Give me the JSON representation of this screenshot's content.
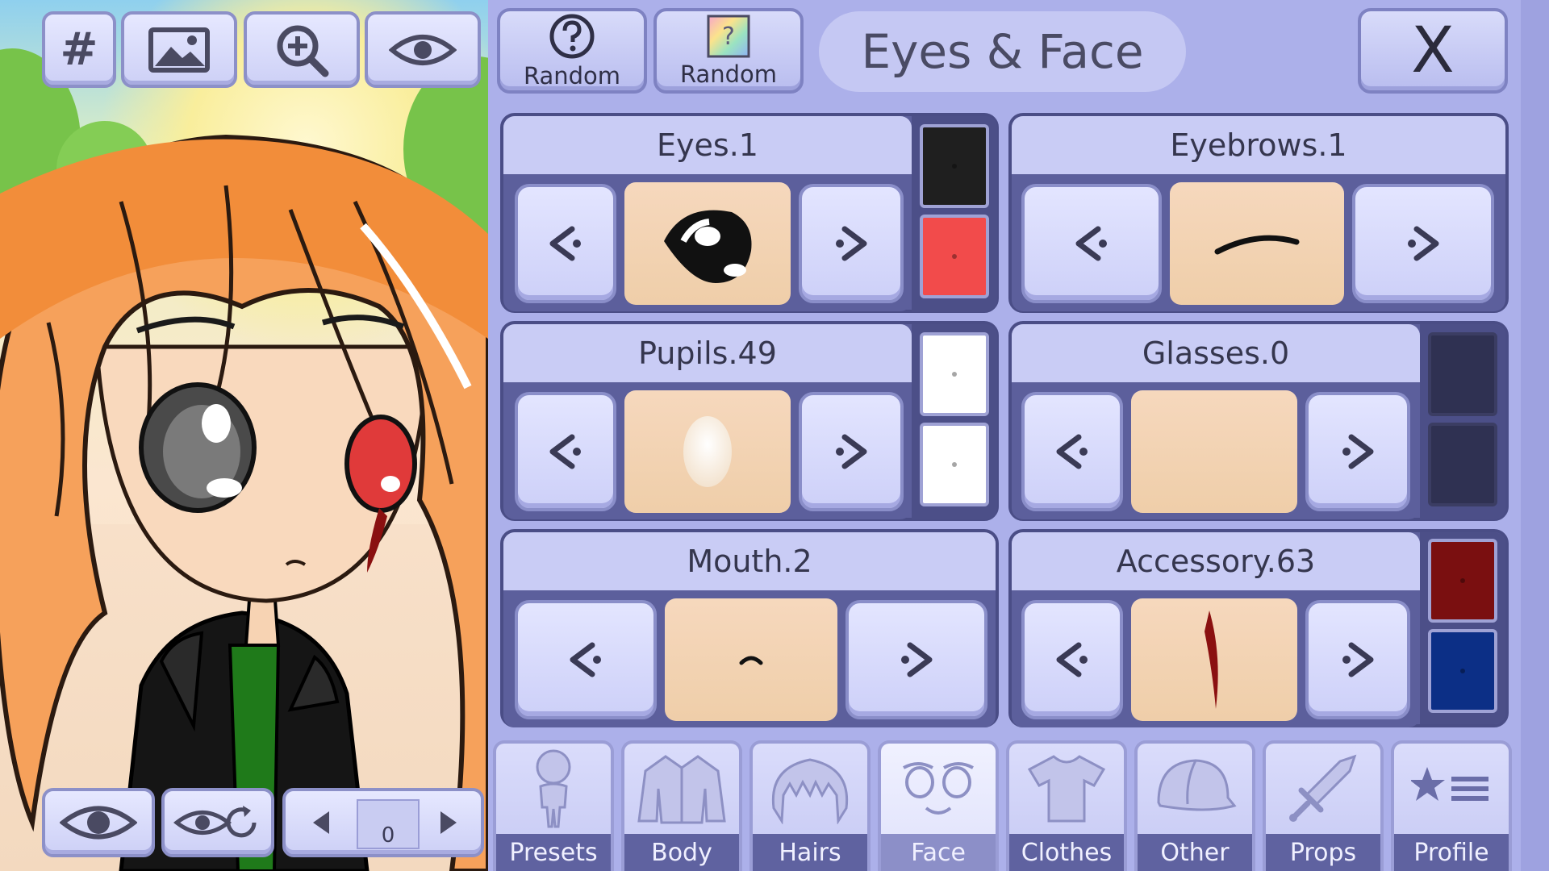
{
  "toolbar": {
    "grid_icon": "#"
  },
  "header": {
    "random_label": "Random",
    "random_color_label": "Random",
    "title": "Eyes & Face",
    "close_label": "X"
  },
  "cards": {
    "eyes": {
      "title": "Eyes.1",
      "colors": [
        "#1f1f1f",
        "#f24b4b"
      ]
    },
    "eyebrows": {
      "title": "Eyebrows.1"
    },
    "pupils": {
      "title": "Pupils.49",
      "colors": [
        "#ffffff",
        "#ffffff"
      ]
    },
    "glasses": {
      "title": "Glasses.0",
      "colors": [
        "#2f3152",
        "#2f3152"
      ]
    },
    "mouth": {
      "title": "Mouth.2"
    },
    "accessory": {
      "title": "Accessory.63",
      "colors": [
        "#7a0f10",
        "#0c2f86"
      ]
    }
  },
  "pose_slot": {
    "value": "0"
  },
  "tabs": [
    {
      "label": "Presets",
      "icon": "person-icon"
    },
    {
      "label": "Body",
      "icon": "jacket-icon"
    },
    {
      "label": "Hairs",
      "icon": "hair-icon"
    },
    {
      "label": "Face",
      "icon": "face-icon",
      "active": true
    },
    {
      "label": "Clothes",
      "icon": "shirt-icon"
    },
    {
      "label": "Other",
      "icon": "cap-icon"
    },
    {
      "label": "Props",
      "icon": "sword-icon"
    },
    {
      "label": "Profile",
      "icon": "star-list-icon"
    }
  ]
}
